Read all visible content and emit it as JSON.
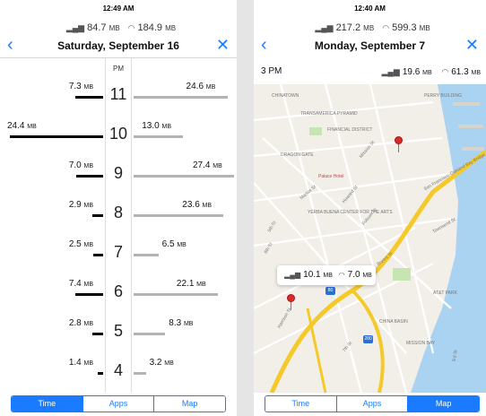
{
  "left": {
    "status_time": "12:49 AM",
    "usage": {
      "cell": "84.7",
      "wifi": "184.9",
      "unit": "MB"
    },
    "title": "Saturday, September 16",
    "period": "PM",
    "rows": [
      {
        "hour": "11",
        "left": "7.3",
        "right": "24.6",
        "left_mb": 7.3,
        "right_mb": 24.6
      },
      {
        "hour": "10",
        "left": "24.4",
        "right": "13.0",
        "left_mb": 24.4,
        "right_mb": 13.0
      },
      {
        "hour": "9",
        "left": "7.0",
        "right": "27.4",
        "left_mb": 7.0,
        "right_mb": 27.4
      },
      {
        "hour": "8",
        "left": "2.9",
        "right": "23.6",
        "left_mb": 2.9,
        "right_mb": 23.6
      },
      {
        "hour": "7",
        "left": "2.5",
        "right": "6.5",
        "left_mb": 2.5,
        "right_mb": 6.5
      },
      {
        "hour": "6",
        "left": "7.4",
        "right": "22.1",
        "left_mb": 7.4,
        "right_mb": 22.1
      },
      {
        "hour": "5",
        "left": "2.8",
        "right": "8.3",
        "left_mb": 2.8,
        "right_mb": 8.3
      },
      {
        "hour": "4",
        "left": "1.4",
        "right": "3.2",
        "left_mb": 1.4,
        "right_mb": 3.2
      }
    ],
    "tabs": [
      "Time",
      "Apps",
      "Map"
    ],
    "active_tab": 0
  },
  "right": {
    "status_time": "12:40 AM",
    "usage": {
      "cell": "217.2",
      "wifi": "599.3",
      "unit": "MB"
    },
    "title": "Monday, September 7",
    "info": {
      "time": "3 PM",
      "cell": "19.6",
      "wifi": "61.3",
      "unit": "MB"
    },
    "tooltip": {
      "cell": "10.1",
      "wifi": "7.0",
      "unit": "MB"
    },
    "map_labels": {
      "chinatown": "CHINATOWN",
      "transamerica": "TRANSAMERICA PYRAMID",
      "financial": "FINANCIAL DISTRICT",
      "dragon": "DRAGON GATE",
      "palace": "Palace Hotel",
      "yerba": "YERBA BUENA CENTER FOR THE ARTS",
      "perry": "PERRY BUILDING",
      "bay_bridge": "San Francisco-Oakland Bay Bridge",
      "att": "AT&T PARK",
      "china_basin": "CHINA BASIN",
      "mission_bay": "MISSION BAY",
      "market": "Market St",
      "mission": "Mission St",
      "howard": "Howard St",
      "folsom": "Folsom St",
      "bryant": "Bryant St",
      "harrison": "Harrison St",
      "townsend": "Townsend St",
      "third": "3rd St",
      "seventh": "7th St",
      "sixth": "6th St",
      "fifth": "5th St",
      "hwy80": "80",
      "hwy280": "280"
    },
    "tabs": [
      "Time",
      "Apps",
      "Map"
    ],
    "active_tab": 2
  },
  "colors": {
    "accent": "#1a7bff",
    "bar_dark": "#000000",
    "bar_light": "#b3b3b3",
    "pin": "#d72a2a",
    "freeway": "#f5c92a"
  },
  "icons": {
    "cellular": "cellular-signal-icon",
    "wifi": "wifi-icon",
    "back": "chevron-left-icon",
    "close": "close-icon",
    "pin": "map-pin-icon"
  }
}
